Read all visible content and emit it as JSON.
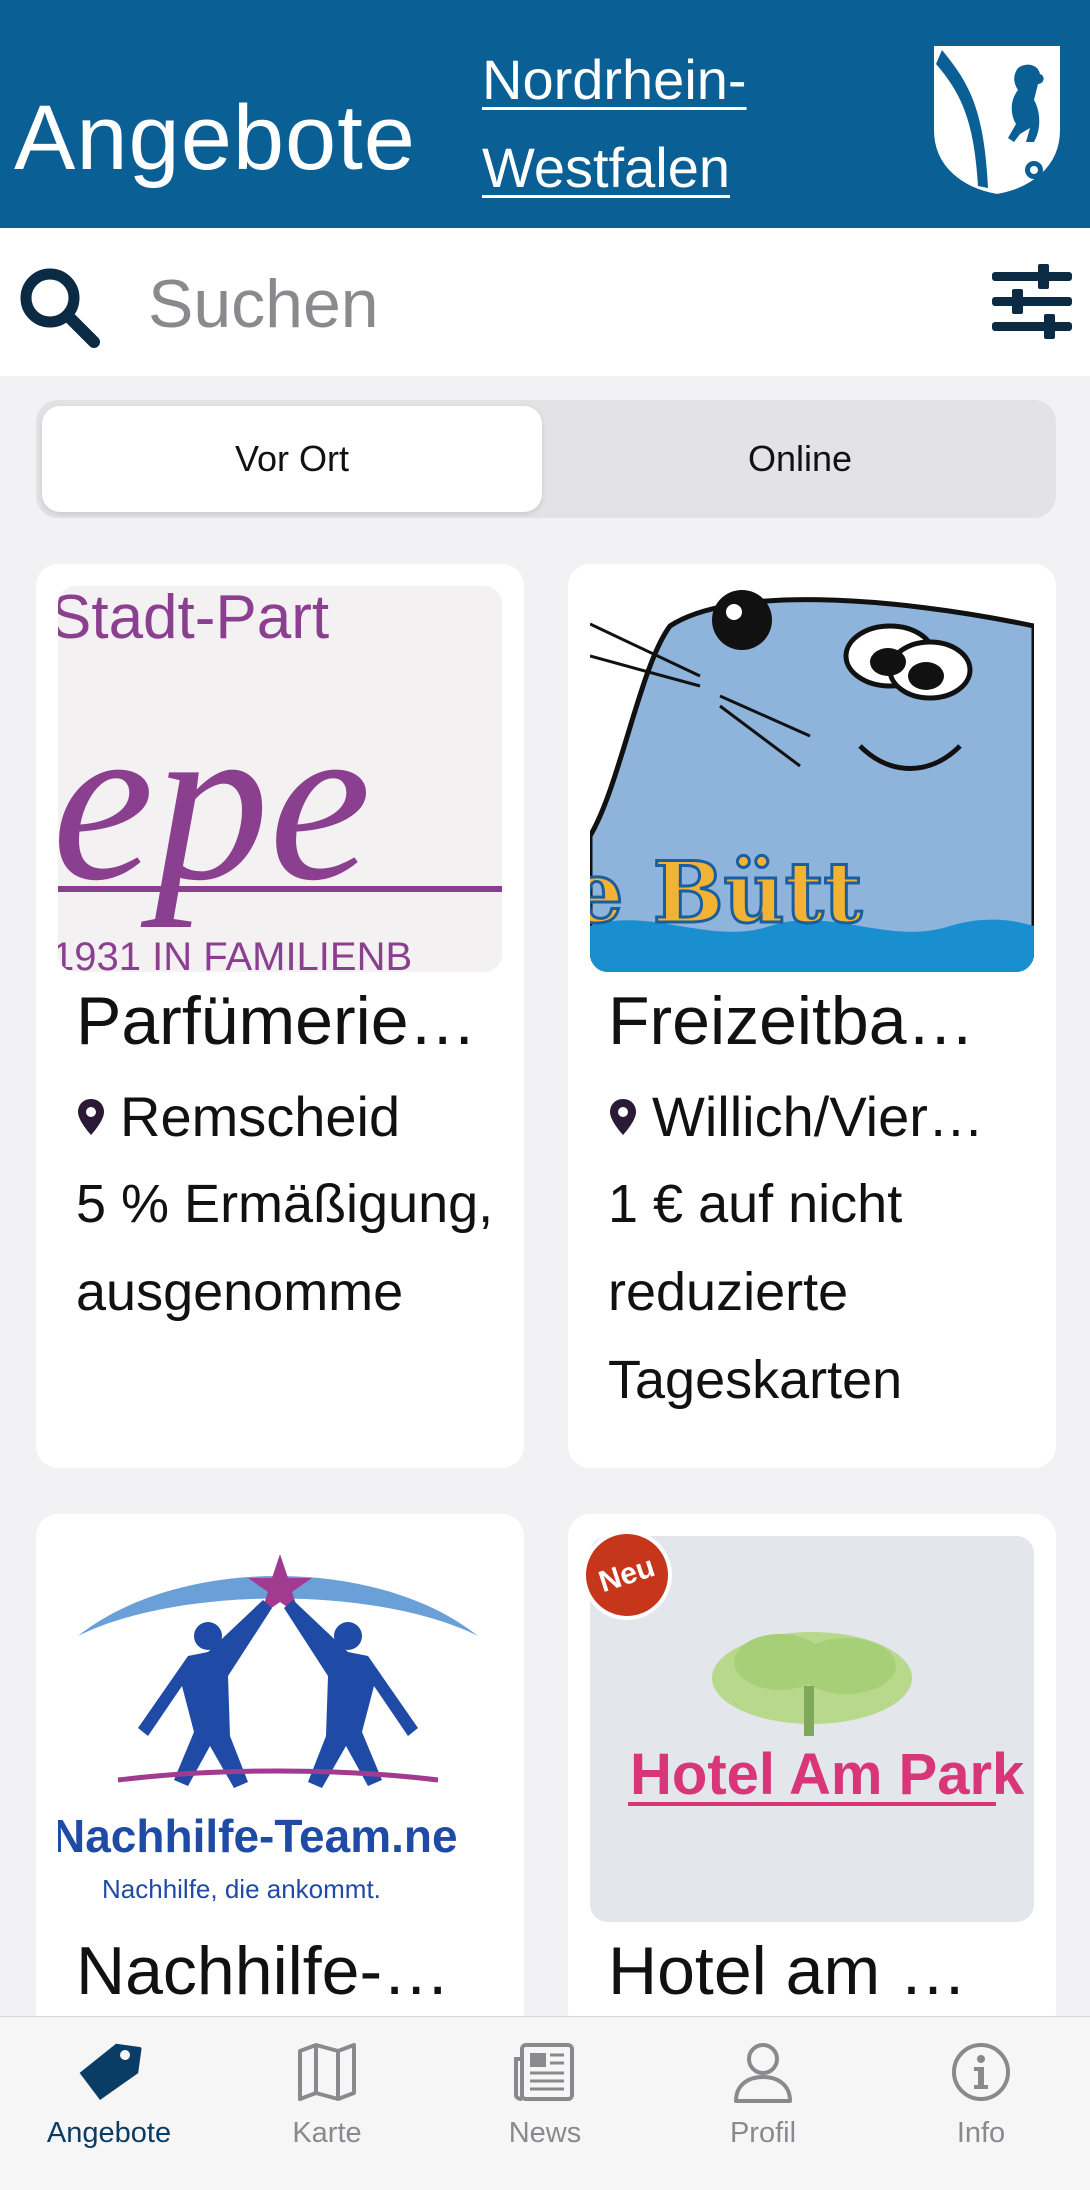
{
  "header": {
    "title": "Angebote",
    "state_line1": "Nordrhein-",
    "state_line2": "Westfalen",
    "crest_icon": "nrw-crest-icon"
  },
  "search": {
    "placeholder": "Suchen",
    "icon": "search-icon",
    "filter_icon": "filter-sliders-icon"
  },
  "segments": {
    "local": "Vor Ort",
    "online": "Online",
    "selected": "Vor Ort"
  },
  "offers": [
    {
      "title": "Parfümerie…",
      "location": "Remscheid",
      "description": "5 % Ermäßigung, ausgenomme",
      "image_text": {
        "line1": "Stadt-Part",
        "line2": "epe",
        "line3": "1931 IN FAMILIENB"
      }
    },
    {
      "title": "Freizeitba…",
      "location": "Willich/Vier…",
      "description": "1 € auf nicht reduzierte Tageskarten",
      "image_text": {
        "logo": "e Bütt"
      }
    },
    {
      "title": "Nachhilfe-…",
      "image_text": {
        "brand": "Nachhilfe-Team.ne",
        "slogan": "Nachhilfe, die ankommt."
      }
    },
    {
      "title": "Hotel am …",
      "badge": "Neu",
      "image_text": {
        "logo": "Hotel Am Park"
      }
    }
  ],
  "tabs": [
    {
      "label": "Angebote",
      "icon": "tag-icon",
      "active": true
    },
    {
      "label": "Karte",
      "icon": "map-icon",
      "active": false
    },
    {
      "label": "News",
      "icon": "newspaper-icon",
      "active": false
    },
    {
      "label": "Profil",
      "icon": "person-icon",
      "active": false
    },
    {
      "label": "Info",
      "icon": "info-icon",
      "active": false
    }
  ],
  "colors": {
    "header_bg": "#0a5f94",
    "accent_dark": "#0a3d66",
    "badge_red": "#c6361a"
  }
}
